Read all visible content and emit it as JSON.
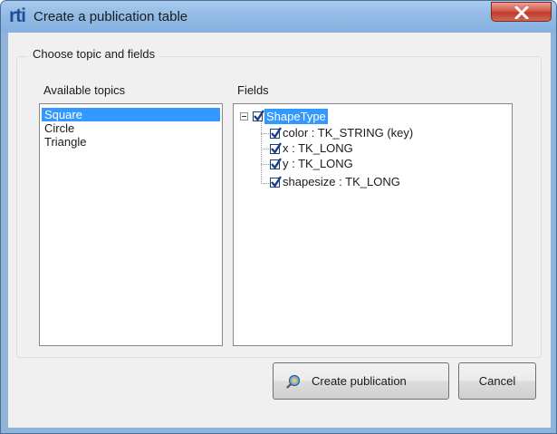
{
  "window": {
    "logo_text": "rti",
    "title": "Create a publication table"
  },
  "group": {
    "title": "Choose topic and fields"
  },
  "topics": {
    "label": "Available topics",
    "items": [
      {
        "label": "Square",
        "selected": true
      },
      {
        "label": "Circle",
        "selected": false
      },
      {
        "label": "Triangle",
        "selected": false
      }
    ]
  },
  "fields": {
    "label": "Fields",
    "root": {
      "label": "ShapeType",
      "checked": true,
      "expanded": true
    },
    "children": [
      {
        "label": "color : TK_STRING (key)",
        "checked": true
      },
      {
        "label": "x : TK_LONG",
        "checked": true
      },
      {
        "label": "y : TK_LONG",
        "checked": true
      },
      {
        "label": "shapesize : TK_LONG",
        "checked": true
      }
    ]
  },
  "buttons": {
    "create_label": "Create publication",
    "cancel_label": "Cancel"
  },
  "icons": {
    "close": "close-icon",
    "create": "publication-icon"
  },
  "colors": {
    "selection": "#3399ff",
    "close_button": "#c9463a",
    "titlebar": "#93bbe6"
  }
}
